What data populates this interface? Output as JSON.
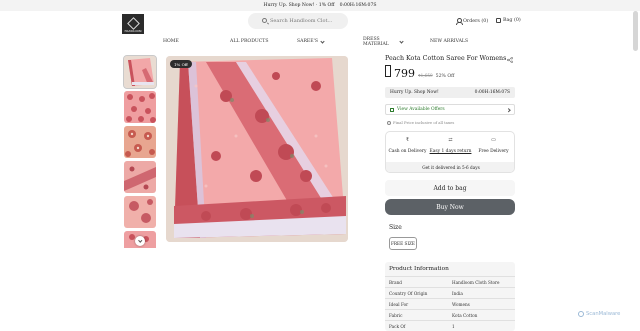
{
  "announcement": {
    "text": "Hurry Up. Shop Now! · 1% Off",
    "timer": "0:00H:16M:07S"
  },
  "header": {
    "logo_text": "HANDLOOM",
    "search_placeholder": "Search Handloom Clot...",
    "orders_label": "Orders (0)",
    "bag_label": "Bag (0)"
  },
  "nav": {
    "items": [
      {
        "label": "HOME",
        "dropdown": false
      },
      {
        "label": "ALL PRODUCTS",
        "dropdown": false
      },
      {
        "label": "SAREE'S",
        "dropdown": true
      },
      {
        "label": "DRESS MATERIAL",
        "dropdown": true
      },
      {
        "label": "NEW ARRIVALS",
        "dropdown": false
      }
    ]
  },
  "gallery": {
    "badge": "1% Off",
    "thumbnail_count": 6
  },
  "product": {
    "title": "Peach Kota Cotton Saree For Womens",
    "price": "799",
    "mrp": "₹1,659",
    "discount": "52% Off",
    "hurry_text": "Hurry Up. Shop Now!",
    "hurry_timer": "0:00H:16M:07S",
    "offers_label": "View Available Offers",
    "tax_note": "Final Price inclusive of all taxes",
    "features": [
      {
        "icon": "rupee-icon",
        "label": "Cash on Delivery"
      },
      {
        "icon": "return-icon",
        "label": "Easy 1 days return"
      },
      {
        "icon": "truck-icon",
        "label": "Free Delivery"
      }
    ],
    "delivery_text": "Get it delivered in 5-6 days",
    "add_to_bag": "Add to bag",
    "buy_now": "Buy Now",
    "size_label": "Size",
    "size_option": "FREE SIZE"
  },
  "product_info": {
    "title": "Product Information",
    "rows": [
      {
        "k": "Brand",
        "v": "Handloom Cloth Store"
      },
      {
        "k": "Country Of Origin",
        "v": "India"
      },
      {
        "k": "Ideal For",
        "v": "Womens"
      },
      {
        "k": "Fabric",
        "v": "Kota Cotton"
      },
      {
        "k": "Pack Of",
        "v": "1"
      }
    ]
  },
  "watermark": "ScanMalware",
  "colors": {
    "saree_pink": "#f2a7a8",
    "saree_border": "#c9525c",
    "buy_button": "#5c6166",
    "offer_green": "#2a7a2a"
  }
}
